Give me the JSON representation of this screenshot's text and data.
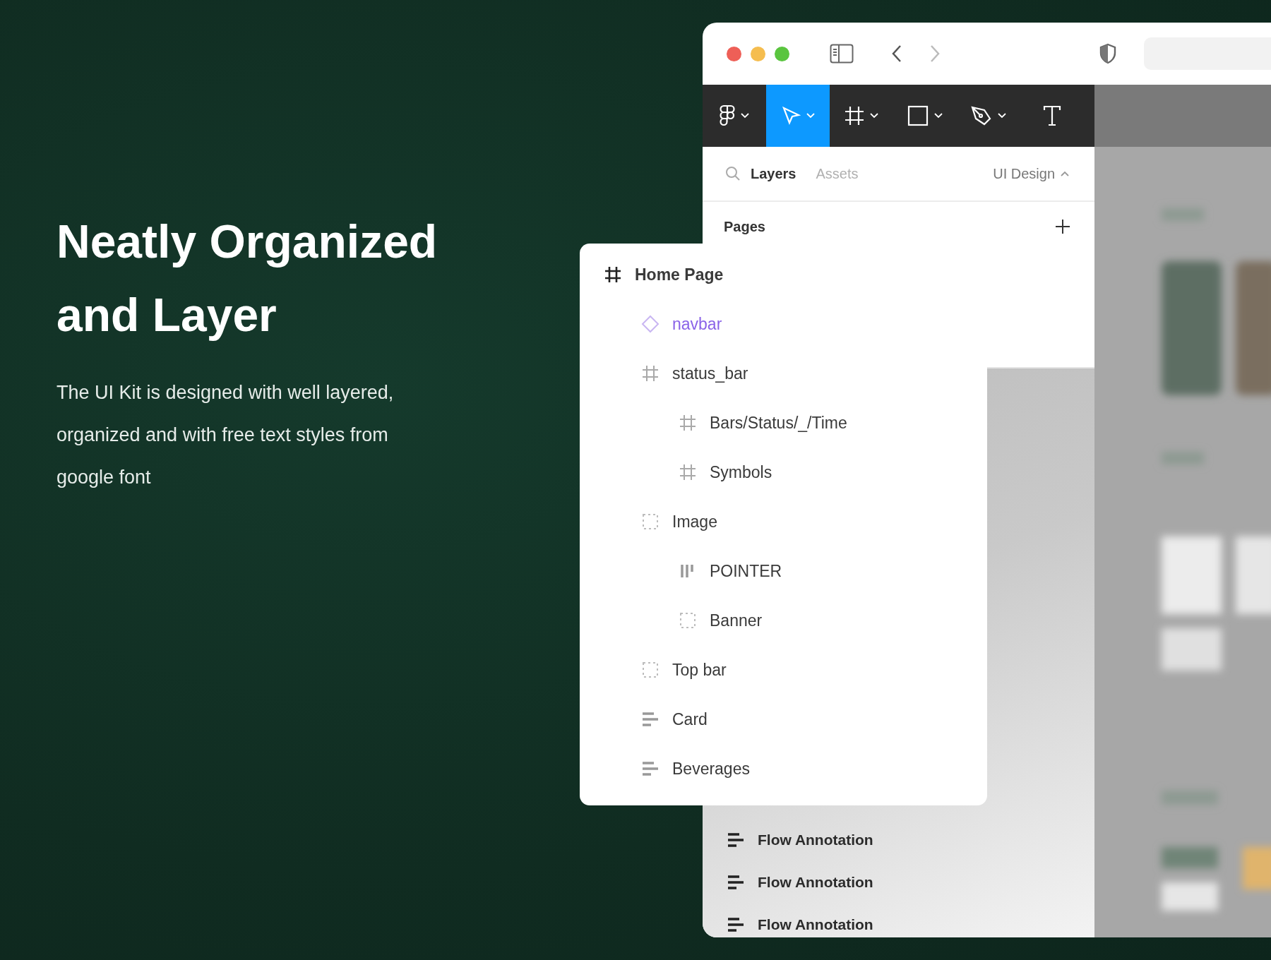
{
  "hero": {
    "title_lines": [
      "Neatly Organized",
      "and Layer"
    ],
    "description_lines": [
      "The UI Kit is designed with well layered,",
      "organized and with free text styles from",
      "google font"
    ]
  },
  "window": {
    "nav": [
      {
        "kind": "back",
        "disabled": false
      },
      {
        "kind": "forward",
        "disabled": true
      }
    ],
    "toolbar": {
      "tools": [
        {
          "kind": "logo",
          "selected": false,
          "dropdown": true
        },
        {
          "kind": "move",
          "selected": true,
          "dropdown": true
        },
        {
          "kind": "frame",
          "selected": false,
          "dropdown": true
        },
        {
          "kind": "rectangle",
          "selected": false,
          "dropdown": true
        },
        {
          "kind": "pen",
          "selected": false,
          "dropdown": true
        },
        {
          "kind": "text",
          "selected": false,
          "dropdown": false
        }
      ]
    },
    "panel": {
      "tabs": [
        {
          "label": "Layers",
          "selected": true
        },
        {
          "label": "Assets",
          "selected": false
        }
      ],
      "page_menu": "UI Design",
      "pages_label": "Pages",
      "annotations": [
        {
          "kind": "text",
          "label": "Flow Annotation"
        },
        {
          "kind": "text",
          "label": "Flow Annotation"
        },
        {
          "kind": "text",
          "label": "Flow Annotation"
        }
      ]
    }
  },
  "layers": [
    {
      "kind": "frame",
      "label": "Home Page",
      "children": [
        {
          "kind": "component",
          "label": "navbar"
        },
        {
          "kind": "frame",
          "label": "status_bar",
          "children": [
            {
              "kind": "frame",
              "label": "Bars/Status/_/Time"
            },
            {
              "kind": "frame",
              "label": "Symbols"
            }
          ]
        },
        {
          "kind": "group",
          "label": "Image",
          "children": [
            {
              "kind": "pointer",
              "label": "POINTER"
            },
            {
              "kind": "group",
              "label": "Banner"
            }
          ]
        },
        {
          "kind": "group",
          "label": "Top bar"
        },
        {
          "kind": "text",
          "label": "Card"
        },
        {
          "kind": "text",
          "label": "Beverages"
        }
      ]
    }
  ]
}
